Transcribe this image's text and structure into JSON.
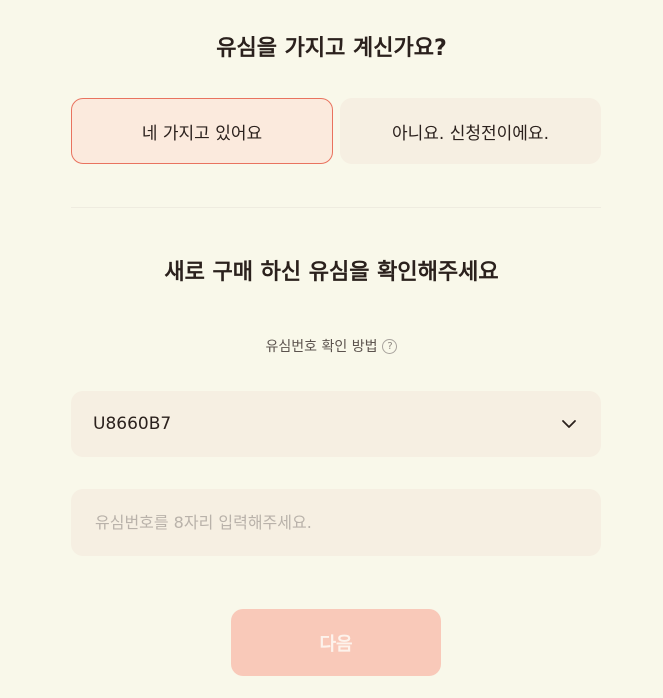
{
  "question": {
    "title": "유심을 가지고 계신가요?",
    "options": [
      {
        "label": "네 가지고 있어요",
        "selected": true
      },
      {
        "label": "아니요. 신청전이에요.",
        "selected": false
      }
    ]
  },
  "confirm_title": "새로 구매 하신 유심을 확인해주세요",
  "help": {
    "label": "유심번호 확인 방법",
    "icon": "?"
  },
  "usim_select": {
    "value": "U8660B7"
  },
  "usim_input": {
    "placeholder": "유심번호를 8자리 입력해주세요.",
    "value": ""
  },
  "next_button": {
    "label": "다음"
  },
  "colors": {
    "background": "#f9f8ea",
    "selected_border": "#e9735f",
    "selected_fill": "#fbeadd",
    "field_fill": "#f6efe2",
    "button_disabled": "#f9c9b9"
  }
}
